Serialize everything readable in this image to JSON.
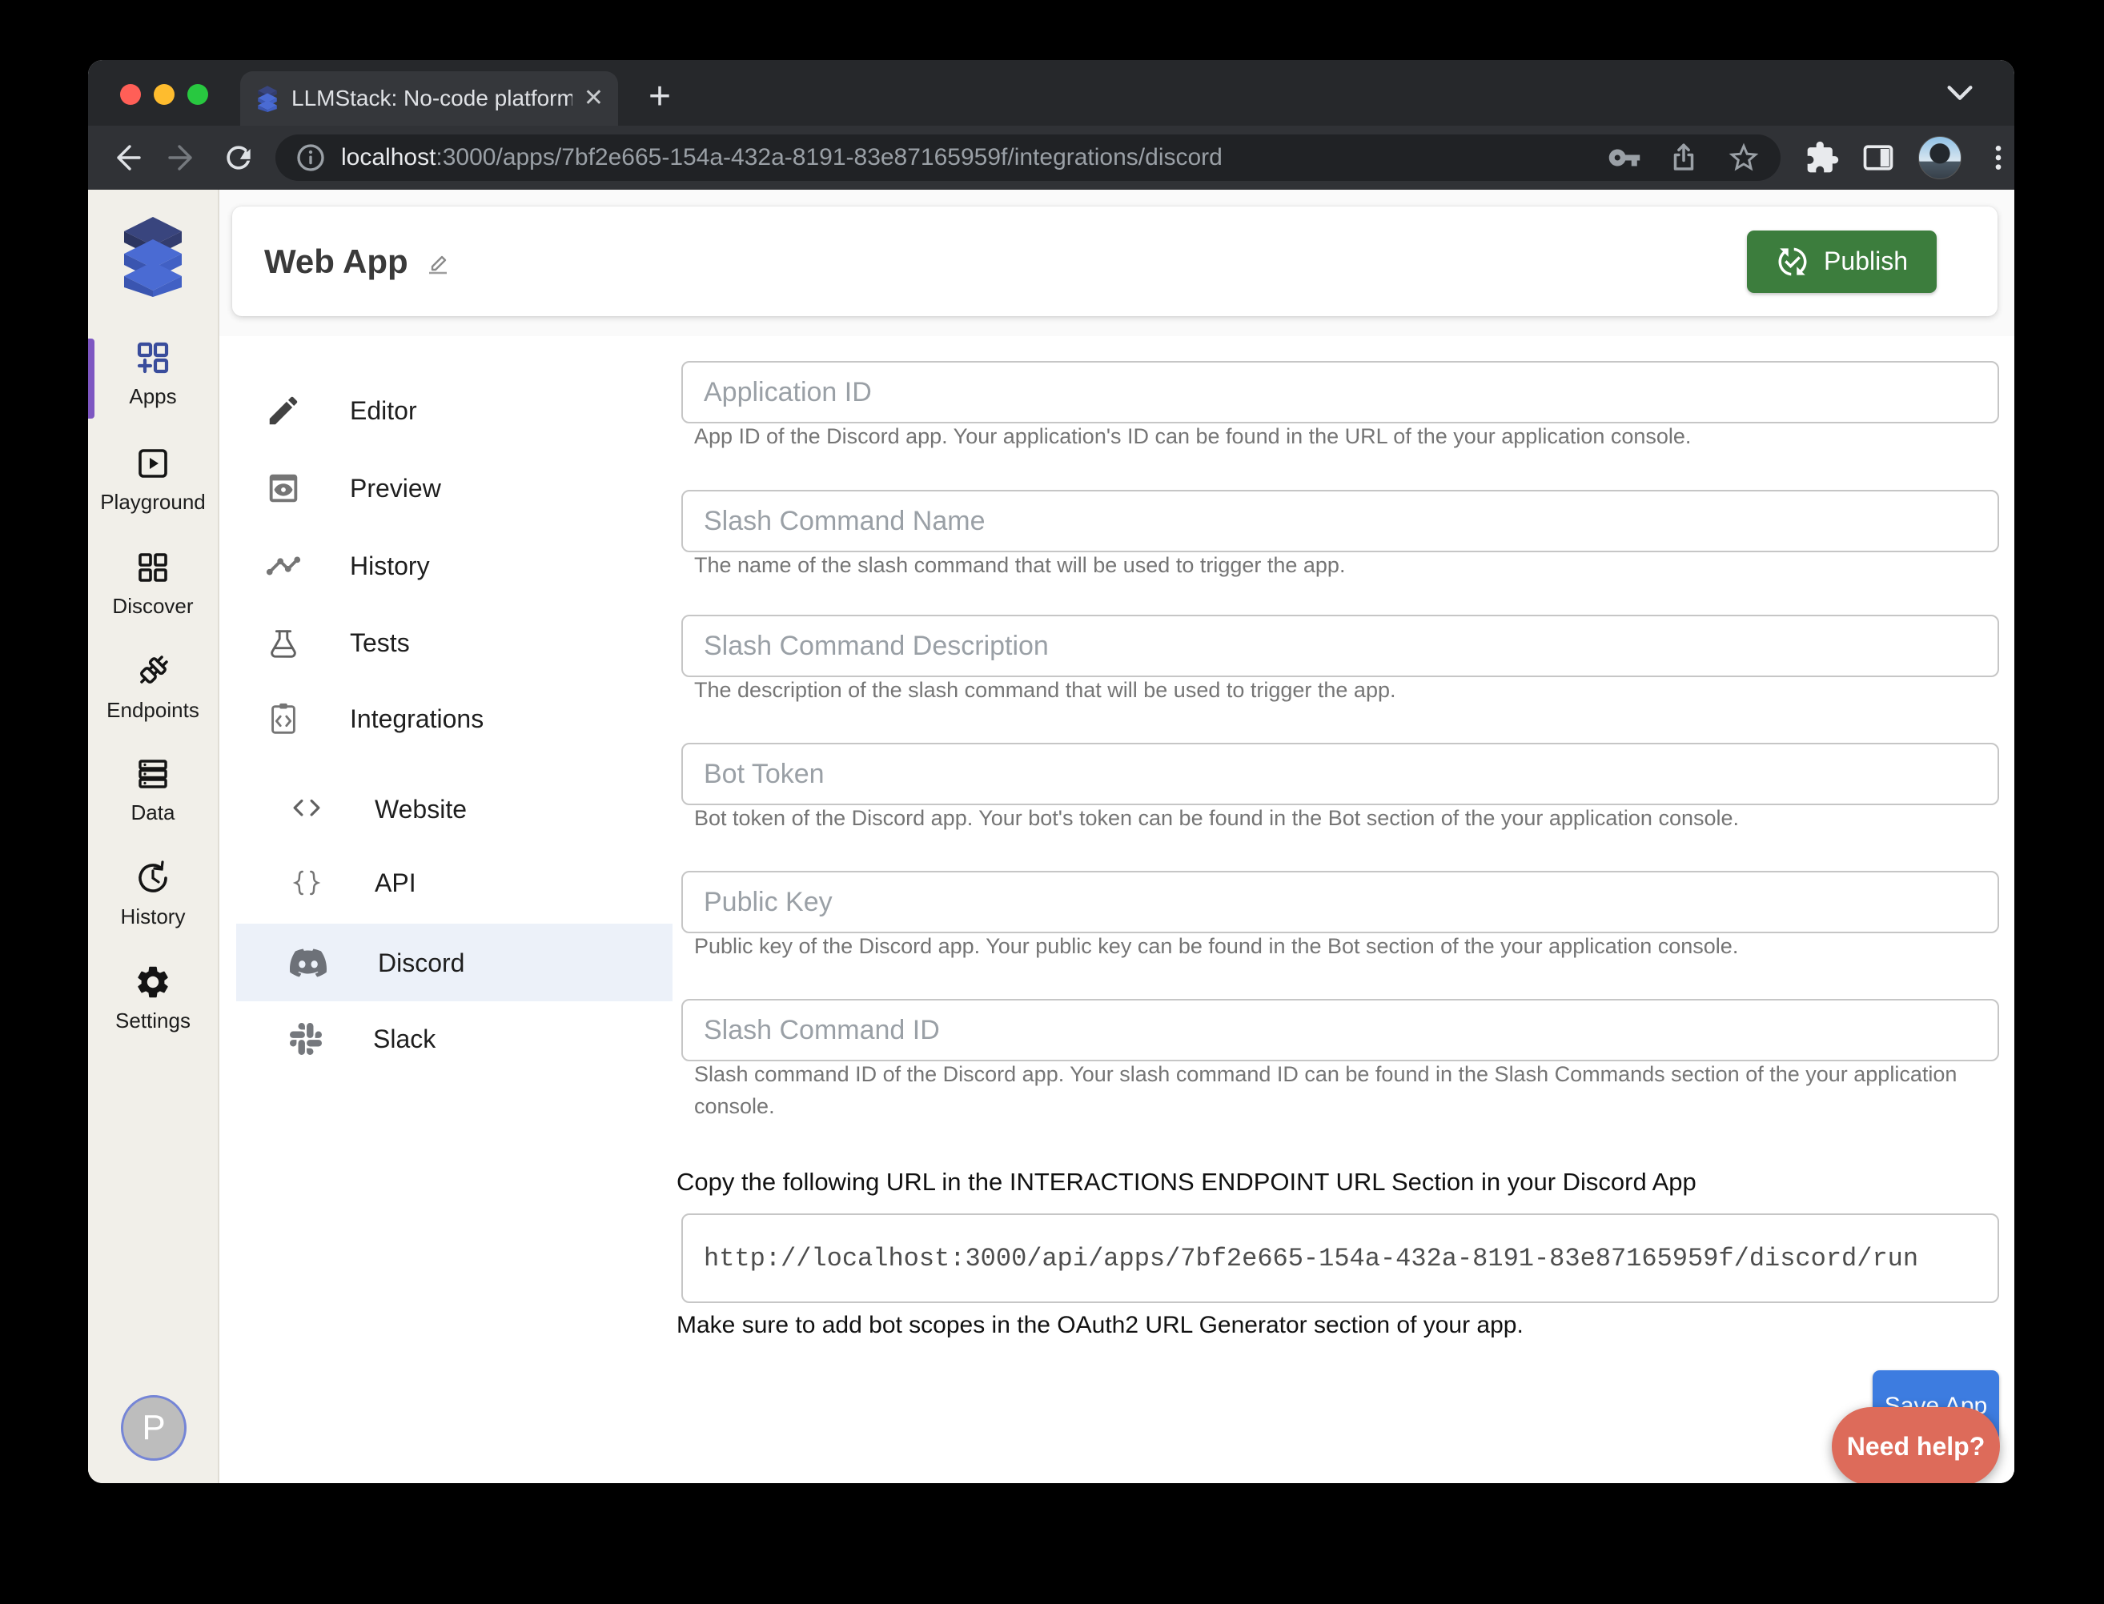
{
  "browser": {
    "tab": {
      "title": "LLMStack: No-code platform to",
      "close_glyph": "✕",
      "new_tab_glyph": "+"
    },
    "url": {
      "host": "localhost",
      "rest": ":3000/apps/7bf2e665-154a-432a-8191-83e87165959f/integrations/discord"
    }
  },
  "sidebar": {
    "items": [
      {
        "label": "Apps",
        "icon": "dashboard-customize-icon",
        "active": true
      },
      {
        "label": "Playground",
        "icon": "slideshow-icon",
        "active": false
      },
      {
        "label": "Discover",
        "icon": "grid-view-icon",
        "active": false
      },
      {
        "label": "Endpoints",
        "icon": "plug-icon",
        "active": false
      },
      {
        "label": "Data",
        "icon": "storage-icon",
        "active": false
      },
      {
        "label": "History",
        "icon": "history-clock-icon",
        "active": false
      },
      {
        "label": "Settings",
        "icon": "gear-icon",
        "active": false
      }
    ],
    "avatar_initial": "P"
  },
  "header": {
    "title": "Web App",
    "publish_label": "Publish"
  },
  "nav": {
    "items": [
      {
        "label": "Editor",
        "icon": "pencil-icon"
      },
      {
        "label": "Preview",
        "icon": "preview-icon"
      },
      {
        "label": "History",
        "icon": "timeline-icon"
      },
      {
        "label": "Tests",
        "icon": "flask-icon"
      },
      {
        "label": "Integrations",
        "icon": "integration-icon"
      }
    ],
    "sub": [
      {
        "label": "Website",
        "icon": "code-brackets-icon",
        "selected": false
      },
      {
        "label": "API",
        "icon": "curly-braces-icon",
        "selected": false
      },
      {
        "label": "Discord",
        "icon": "discord-icon",
        "selected": true
      },
      {
        "label": "Slack",
        "icon": "slack-icon",
        "selected": false
      }
    ]
  },
  "form": {
    "fields": [
      {
        "placeholder": "Application ID",
        "value": "",
        "helper": "App ID of the Discord app. Your application's ID can be found in the URL of the your application console."
      },
      {
        "placeholder": "Slash Command Name",
        "value": "",
        "helper": "The name of the slash command that will be used to trigger the app."
      },
      {
        "placeholder": "Slash Command Description",
        "value": "",
        "helper": "The description of the slash command that will be used to trigger the app."
      },
      {
        "placeholder": "Bot Token",
        "value": "",
        "helper": "Bot token of the Discord app. Your bot's token can be found in the Bot section of the your application console."
      },
      {
        "placeholder": "Public Key",
        "value": "",
        "helper": "Public key of the Discord app. Your public key can be found in the Bot section of the your application console."
      },
      {
        "placeholder": "Slash Command ID",
        "value": "",
        "helper": "Slash command ID of the Discord app. Your slash command ID can be found in the Slash Commands section of the your application console."
      }
    ]
  },
  "endpoint": {
    "heading": "Copy the following URL in the INTERACTIONS ENDPOINT URL Section in your Discord App",
    "url": "http://localhost:3000/api/apps/7bf2e665-154a-432a-8191-83e87165959f/discord/run",
    "note": "Make sure to add bot scopes in the OAuth2 URL Generator section of your app."
  },
  "actions": {
    "save_label": "Save App",
    "help_label": "Need help?"
  },
  "colors": {
    "publish_green": "#3c7d3d",
    "save_blue": "#3d7ce0",
    "help_coral": "#dd6b5a",
    "active_indicator_purple": "#7e57c2",
    "apps_icon_indigo": "#3a4d9c",
    "selected_row": "#ecf1f9",
    "sidebar_bg": "#f1efe9",
    "traffic_red": "#ff5f57",
    "traffic_yellow": "#febc2e",
    "traffic_green": "#28c840"
  }
}
